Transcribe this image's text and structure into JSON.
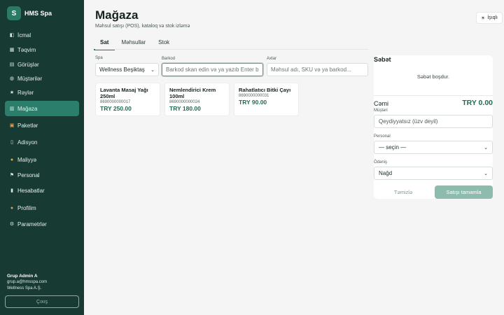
{
  "brand": {
    "logo_letter": "S",
    "name": "HMS Spa"
  },
  "sidebar": {
    "items": [
      {
        "label": "İcmal",
        "icon": "dashboard-icon",
        "glyph": "◧"
      },
      {
        "label": "Təqvim",
        "icon": "calendar-icon",
        "glyph": "▦"
      },
      {
        "label": "Görüşlər",
        "icon": "appointments-icon",
        "glyph": "▤"
      },
      {
        "label": "Müştərilər",
        "icon": "customers-icon",
        "glyph": "◍"
      },
      {
        "label": "Rəylər",
        "icon": "star-icon",
        "glyph": "★"
      },
      {
        "label": "Mağaza",
        "icon": "store-icon",
        "glyph": "▥",
        "active": true
      },
      {
        "label": "Paketlər",
        "icon": "package-icon",
        "glyph": "▣"
      },
      {
        "label": "Adisyon",
        "icon": "receipt-icon",
        "glyph": "▯"
      },
      {
        "label": "Maliyyə",
        "icon": "money-bag-icon",
        "glyph": "●"
      },
      {
        "label": "Personal",
        "icon": "flag-icon",
        "glyph": "⚑"
      },
      {
        "label": "Hesabatlar",
        "icon": "reports-icon",
        "glyph": "▮"
      },
      {
        "label": "Profilim",
        "icon": "profile-icon",
        "glyph": "●"
      },
      {
        "label": "Parametrlər",
        "icon": "gear-icon",
        "glyph": "⚙"
      }
    ]
  },
  "user": {
    "name": "Grup Admin A",
    "email": "grup.a@hmsspa.com",
    "org": "Wellness Spa A.Ş.",
    "logout_label": "Çıxış"
  },
  "header": {
    "title": "Mağaza",
    "subtitle": "Məhsul satışı (POS), kataloq və stok izləmə",
    "lang_label": "İşıqlı",
    "lang_icon_glyph": "☀"
  },
  "tabs": [
    {
      "label": "Sat",
      "active": true
    },
    {
      "label": "Məhsullar"
    },
    {
      "label": "Stok"
    }
  ],
  "filters": {
    "spa_label": "Spa",
    "spa_value": "Wellness Beşiktaş",
    "barcode_label": "Barkod",
    "barcode_placeholder": "Barkod skan edin və ya yazıb Enter b",
    "search_label": "Axtar",
    "search_placeholder": "Məhsul adı, SKU və ya barkod..."
  },
  "products": [
    {
      "name": "Lavanta Masaj Yağı 250ml",
      "code": "8690000000017",
      "price": "TRY 250.00"
    },
    {
      "name": "Nemlendirici Krem 100ml",
      "code": "8690000000024",
      "price": "TRY 180.00"
    },
    {
      "name": "Rahatlatıcı Bitki Çayı",
      "code": "8690000000031",
      "price": "TRY 90.00"
    }
  ],
  "cart": {
    "title": "Səbət",
    "empty_text": "Səbət boşdur.",
    "total_label": "Cəmi",
    "total_value": "TRY 0.00",
    "customer_label": "Müştəri",
    "customer_placeholder": "Qeydiyyatsız (üzv deyil)",
    "staff_label": "Personal",
    "staff_value": "— seçin —",
    "payment_label": "Ödəniş",
    "payment_value": "Nağd",
    "clear_label": "Təmizlə",
    "complete_label": "Satışı tamamla"
  },
  "colors": {
    "sidebar_bg": "#173a33",
    "accent": "#2b7e6b",
    "price": "#1f6b55"
  }
}
